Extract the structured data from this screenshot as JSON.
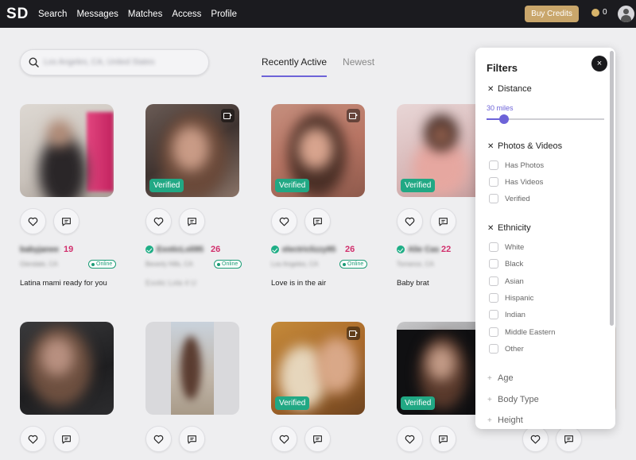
{
  "nav": {
    "logo": "SD",
    "links": [
      "Search",
      "Messages",
      "Matches",
      "Access",
      "Profile"
    ],
    "buy_credits": "Buy Credits",
    "credits": "0"
  },
  "search": {
    "value": "Los Angeles, CA, United States"
  },
  "tabs": [
    {
      "label": "Recently Active",
      "active": true
    },
    {
      "label": "Newest",
      "active": false
    }
  ],
  "cards": [
    {
      "name": "babyjanee",
      "age": "19",
      "location": "Glendale, CA",
      "online": "Online",
      "bio": "Latina mami ready for you",
      "bio_blurred": false,
      "verified_badge": "",
      "verified_check": false,
      "video": false
    },
    {
      "name": "ExoticLoli95",
      "age": "26",
      "location": "Beverly Hills, CA",
      "online": "Online",
      "bio": "Exotic Lola 4 U",
      "bio_blurred": true,
      "verified_badge": "Verified",
      "verified_check": true,
      "video": true
    },
    {
      "name": "electriclizzy95",
      "age": "26",
      "location": "Los Angeles, CA",
      "online": "Online",
      "bio": "Love is in the air",
      "bio_blurred": false,
      "verified_badge": "Verified",
      "verified_check": true,
      "video": true
    },
    {
      "name": "Alie Cas",
      "age": "22",
      "location": "Torrance, CA",
      "online": "",
      "bio": "Baby brat",
      "bio_blurred": false,
      "verified_badge": "Verified",
      "verified_check": true,
      "video": false
    },
    {
      "verified_badge": "",
      "video": false
    },
    {
      "verified_badge": "",
      "video": false
    },
    {
      "verified_badge": "Verified",
      "video": true
    },
    {
      "verified_badge": "Verified",
      "video": false
    }
  ],
  "filters": {
    "title": "Filters",
    "close": "×",
    "distance": {
      "label": "Distance",
      "value": "30 miles",
      "slider_fraction": 0.15
    },
    "photos_videos": {
      "label": "Photos & Videos",
      "options": [
        "Has Photos",
        "Has Videos",
        "Verified"
      ]
    },
    "ethnicity": {
      "label": "Ethnicity",
      "options": [
        "White",
        "Black",
        "Asian",
        "Hispanic",
        "Indian",
        "Middle Eastern",
        "Other"
      ]
    },
    "collapsed": [
      "Age",
      "Body Type",
      "Height"
    ]
  },
  "colors": {
    "accent": "#6d63d8",
    "verified": "#21a884",
    "age": "#d1306d",
    "nav_bg": "#1b1b1f",
    "buy_credits": "#c9a66b"
  }
}
